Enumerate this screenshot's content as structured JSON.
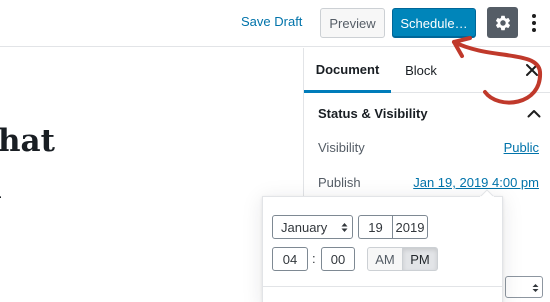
{
  "toolbar": {
    "save_draft_label": "Save Draft",
    "preview_label": "Preview",
    "schedule_label": "Schedule…",
    "settings_icon": "gear-icon",
    "more_icon": "more-vertical-icon"
  },
  "editor": {
    "title_line_1": "hat",
    "title_line_2": "l"
  },
  "sidebar": {
    "tabs": [
      {
        "label": "Document",
        "active": true
      },
      {
        "label": "Block",
        "active": false
      }
    ],
    "close_icon": "close-icon",
    "panel": {
      "title": "Status & Visibility",
      "expanded": true,
      "rows": [
        {
          "label": "Visibility",
          "value": "Public"
        },
        {
          "label": "Publish",
          "value": "Jan 19, 2019 4:00 pm"
        }
      ]
    }
  },
  "date_picker": {
    "month": "January",
    "day": "19",
    "year": "2019",
    "hour": "04",
    "minute": "00",
    "separator": ":",
    "am_label": "AM",
    "pm_label": "PM",
    "selected_period": "PM"
  },
  "colors": {
    "accent": "#0085ba",
    "link": "#0073aa",
    "annotation": "#c0392b",
    "settings_button": "#555d66"
  }
}
